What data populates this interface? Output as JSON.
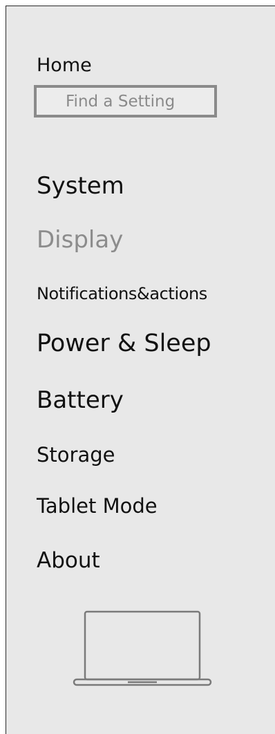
{
  "sidebar": {
    "home_label": "Home",
    "search": {
      "placeholder": "Find a Setting"
    },
    "items": [
      {
        "label": "System"
      },
      {
        "label": "Display"
      },
      {
        "label": "Notifications&actions"
      },
      {
        "label": "Power & Sleep"
      },
      {
        "label": "Battery"
      },
      {
        "label": "Storage"
      },
      {
        "label": "Tablet Mode"
      },
      {
        "label": "About"
      }
    ],
    "active_item": "Display",
    "illustration_icon": "laptop-icon"
  },
  "colors": {
    "panel_background": "#e8e8e8",
    "text": "#111111",
    "selected_text": "#8c8c8c",
    "search_border": "#8a8a8a"
  }
}
